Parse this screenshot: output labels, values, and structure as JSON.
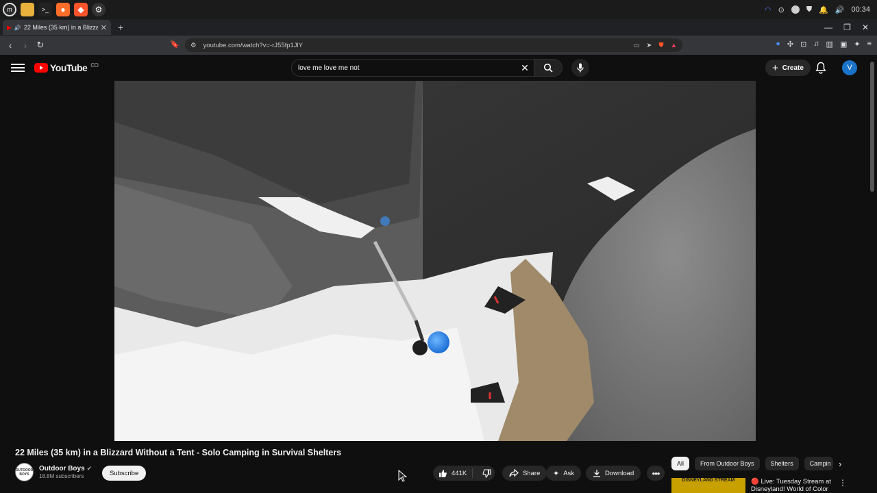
{
  "os": {
    "apps": [
      "mint-menu",
      "files",
      "terminal",
      "firefox",
      "brave",
      "settings"
    ],
    "clock": "00:34"
  },
  "browser": {
    "tab_title": "22 Miles (35 km) in a Blizza",
    "url": "youtube.com/watch?v=-rJ55fp1JlY"
  },
  "youtube": {
    "logo_text": "YouTube",
    "logo_sup": "CO",
    "search_value": "love me love me not",
    "create_label": "Create",
    "avatar_letter": "V"
  },
  "video": {
    "title": "22 Miles (35 km) in a Blizzard Without a Tent - Solo Camping in Survival Shelters",
    "channel": "Outdoor Boys",
    "channel_logo_text": "OUTDOOR BOYS",
    "subscribers": "18.8M subscribers",
    "subscribe_label": "Subscribe",
    "likes": "441K",
    "share_label": "Share",
    "ask_label": "Ask",
    "download_label": "Download"
  },
  "chips": [
    "All",
    "From Outdoor Boys",
    "Shelters",
    "Campin"
  ],
  "recommendation": {
    "thumb_text": "DISNEYLAND STREAM",
    "title": "🔴 Live: Tuesday Stream at Disneyland! World of Color"
  },
  "colors": {
    "brand": "#ff0000",
    "background": "#0f0f0f",
    "avatar": "#1a73c8"
  }
}
